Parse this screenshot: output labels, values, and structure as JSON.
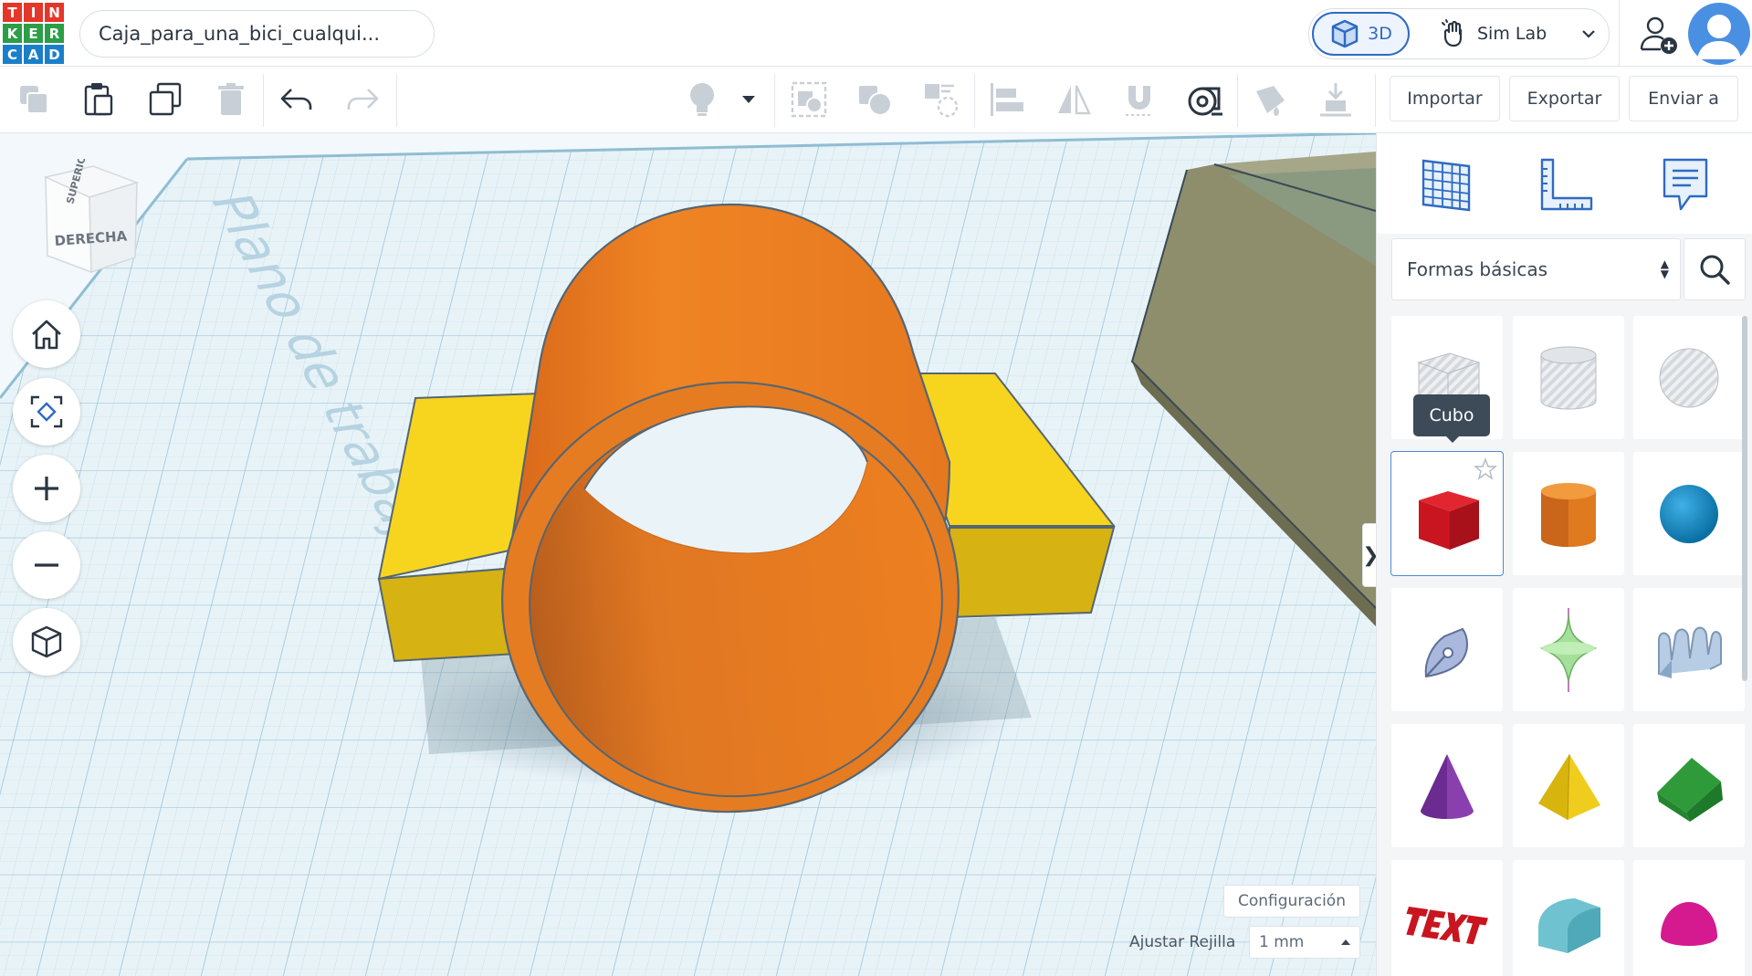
{
  "app": {
    "logo_letters": [
      "T",
      "I",
      "N",
      "K",
      "E",
      "R",
      "C",
      "A",
      "D"
    ],
    "logo_colors": [
      "#e5362a",
      "#e5362a",
      "#e5362a",
      "#2c9e47",
      "#2c9e47",
      "#2c9e47",
      "#1a7fc9",
      "#1a7fc9",
      "#1a7fc9"
    ],
    "design_name": "Caja_para_una_bici_cualqui...",
    "mode_3d_label": "3D",
    "mode_sim_label": "Sim Lab"
  },
  "toolbar": {
    "import_label": "Importar",
    "export_label": "Exportar",
    "send_label": "Enviar a"
  },
  "viewport": {
    "viewcube_top": "SUPERIOR",
    "viewcube_right": "DERECHA",
    "workplane_label": "Plano de trabajo",
    "config_label": "Configuración",
    "grid_snap_label": "Ajustar Rejilla",
    "grid_snap_value": "1 mm",
    "panel_toggle_glyph": "❯"
  },
  "panel": {
    "library_label": "Formas básicas",
    "tooltip": "Cubo"
  },
  "colors": {
    "accent": "#2f6ac4",
    "cylinder_orange": "#ec7f20",
    "block_yellow": "#f6d21d",
    "box_olive": "#8e8e6d"
  }
}
